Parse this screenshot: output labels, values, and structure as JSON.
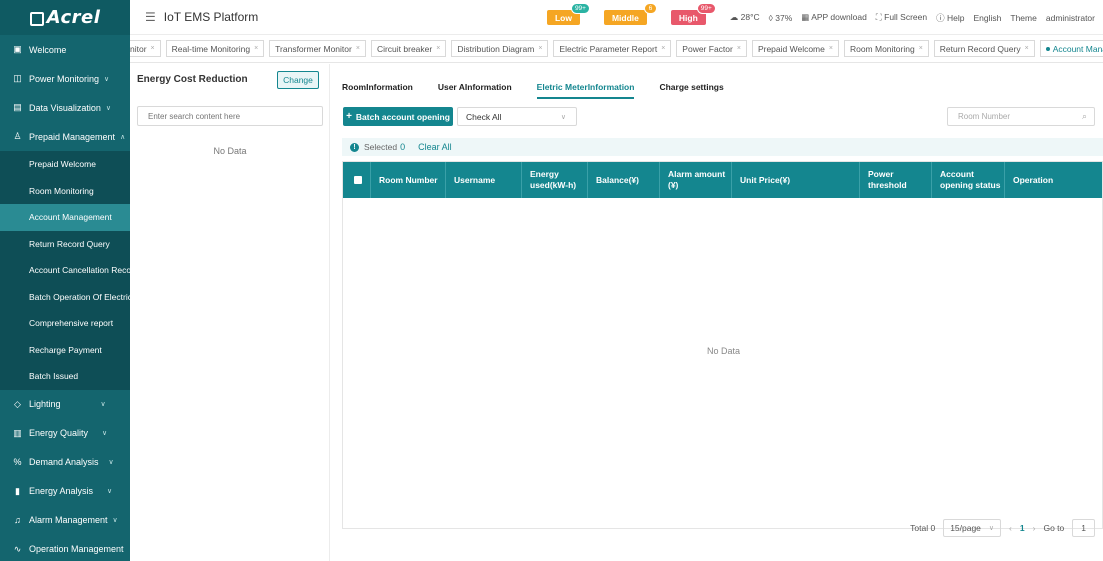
{
  "brand": {
    "logo": "Acrel"
  },
  "topbar": {
    "title": "IoT EMS Platform",
    "alarms": [
      {
        "label": "Low",
        "count": "99+",
        "color": "#f5a623",
        "badge_color": "#2bb3a3"
      },
      {
        "label": "Middle",
        "count": "6",
        "color": "#f5a623",
        "badge_color": "#f5a623"
      },
      {
        "label": "High",
        "count": "99+",
        "color": "#e8586b",
        "badge_color": "#e8586b"
      }
    ],
    "temperature": "28°C",
    "humidity": "37%",
    "app_download": "APP download",
    "full_screen": "Full Screen",
    "help": "Help",
    "language": "English",
    "theme": "Theme",
    "user": "administrator"
  },
  "sidebar": {
    "welcome": "Welcome",
    "power_monitoring": "Power Monitoring",
    "data_visualization": "Data Visualization",
    "prepaid_management": "Prepaid Management",
    "prepaid_items": [
      "Prepaid Welcome",
      "Room Monitoring",
      "Account Management",
      "Return Record Query",
      "Account Cancellation Record",
      "Batch Operation Of Electric",
      "Comprehensive report",
      "Recharge Payment",
      "Batch Issued"
    ],
    "lighting": "Lighting",
    "energy_quality": "Energy Quality",
    "demand_analysis": "Demand Analysis",
    "energy_analysis": "Energy Analysis",
    "alarm_management": "Alarm Management",
    "operation_management": "Operation Management"
  },
  "tabs": [
    "nitor",
    "Real-time Monitoring",
    "Transformer Monitor",
    "Circuit breaker",
    "Distribution Diagram",
    "Electric Parameter Report",
    "Power Factor",
    "Prepaid Welcome",
    "Room Monitoring",
    "Return Record Query",
    "Account Management"
  ],
  "left_panel": {
    "title": "Energy Cost Reduction",
    "change_label": "Change",
    "search_placeholder": "Enter search content here",
    "empty": "No Data"
  },
  "main": {
    "subtabs": [
      "RoomInformation",
      "User AInformation",
      "Eletric MeterInformation",
      "Charge settings"
    ],
    "active_subtab": 2,
    "batch_label": "Batch account opening",
    "check_select": "Check All",
    "room_search_placeholder": "Room Number",
    "selected_label": "Selected",
    "selected_count": "0",
    "clear_all": "Clear All",
    "columns": [
      "Room Number",
      "Username",
      "Energy used(kW-h)",
      "Balance(¥)",
      "Alarm amount (¥)",
      "Unit Price(¥)",
      "Power threshold",
      "Account opening status",
      "Operation"
    ],
    "empty": "No Data"
  },
  "pager": {
    "total": "Total 0",
    "page_size": "15/page",
    "current": "1",
    "goto_label": "Go to",
    "goto_value": "1"
  }
}
